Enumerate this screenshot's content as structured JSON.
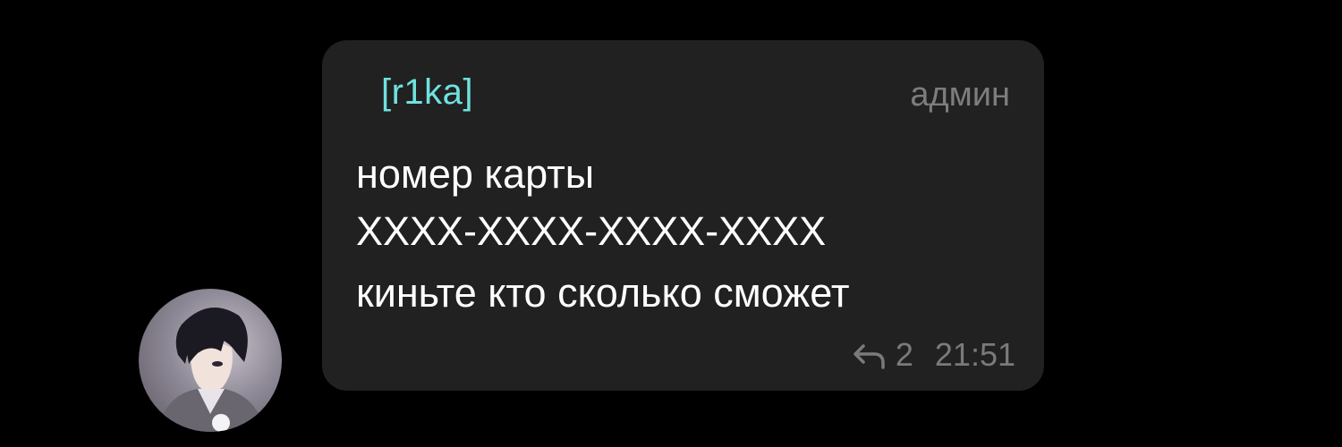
{
  "message": {
    "sender": "[r1ka]",
    "role": "админ",
    "lines": [
      "номер карты",
      "XXXX-XXXX-XXXX-XXXX",
      "киньте кто сколько сможет"
    ],
    "reply_count": "2",
    "time": "21:51"
  },
  "colors": {
    "background": "#000000",
    "bubble": "#212121",
    "sender": "#6fe2df",
    "meta": "#7a7a7a",
    "text": "#ffffff"
  },
  "icons": {
    "reply": "reply-icon",
    "avatar": "user-avatar"
  }
}
